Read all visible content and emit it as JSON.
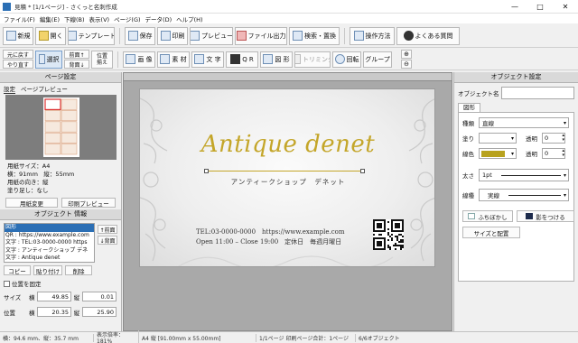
{
  "window": {
    "title": "見積 * [1/1ページ] - さくっと名刺作成",
    "controls": [
      "—",
      "□",
      "✕"
    ]
  },
  "menu": [
    "ファイル(F)",
    "編集(E)",
    "下線(B)",
    "表示(V)",
    "ページ(G)",
    "データ(D)",
    "ヘルプ(H)"
  ],
  "toolbar": {
    "new": "新規",
    "open": "開く",
    "template": "テンプレート",
    "save": "保存",
    "print": "印刷",
    "preview": "プレビュー",
    "file_output": "ファイル出力",
    "search_replace": "検索・置換",
    "howto": "操作方法",
    "faq": "よくある質問"
  },
  "objbar": {
    "undo": "元に戻す",
    "redo": "やり直す",
    "select": "選択",
    "front": "前面↑",
    "back": "背面↓",
    "align1": "位置",
    "align2": "揃え",
    "image": "画 像",
    "material": "素 材",
    "text": "文 字",
    "qr": "Q R",
    "shape": "図 形",
    "trimming": "トリミング",
    "rotate": "回転",
    "group": "グループ"
  },
  "page_settings": {
    "header": "ページ設定",
    "tabs": [
      "設定",
      "ページプレビュー"
    ],
    "paper_size": "用紙サイズ：A4",
    "dimensions": "横：91mm　縦：55mm",
    "orientation": "用紙の向き：縦",
    "bleed": "塗り足し：なし",
    "change_paper": "用紙変更",
    "print_preview": "印刷プレビュー"
  },
  "object_info": {
    "header": "オブジェクト 情報",
    "list": [
      "図形",
      "QR : https://www.example.com",
      "文字 : TEL:03-0000-0000  https",
      "文字 : アンティークショップ デネ",
      "文字 : Antique denet"
    ],
    "front": "↑前面",
    "back": "↓背面",
    "copy": "コピー",
    "paste": "貼り付け",
    "delete": "削除",
    "fix_position": "位置を固定",
    "size_label": "サイズ",
    "pos_label": "位置",
    "w_label": "横",
    "h_label": "縦",
    "size_w": "49.85",
    "size_h": "0.01",
    "pos_x": "20.35",
    "pos_y": "25.90"
  },
  "card": {
    "title": "Antique denet",
    "subtitle": "アンティークショップ　デネット",
    "contact": "TEL:03-0000-0000　https://www.example.com",
    "hours": "Open 11:00 – Close 19:00　定休日　毎週月曜日"
  },
  "object_settings": {
    "header": "オブジェクト設定",
    "name_label": "オブジェクト名",
    "tab": "図形",
    "type_label": "種類",
    "type_value": "直線",
    "fill_label": "塗り",
    "fill_alpha_label": "透明",
    "fill_alpha": "0",
    "line_color_label": "線色",
    "line_alpha_label": "透明",
    "line_alpha": "0",
    "width_label": "太さ",
    "width_value": "1pt",
    "style_label": "線種",
    "style_value": "実線",
    "blur": "ふちぼかし",
    "shadow": "影をつける",
    "size_position": "サイズと配置",
    "line_color": "#b8a21e"
  },
  "status": {
    "coords": "横：94.6 mm、縦：35.7 mm",
    "zoom": "表示倍率：181%",
    "paper": "A4 縦 [91.00mm x 55.00mm]",
    "pages": "1/1ページ 印刷ページ合計：1ページ",
    "objects": "6/6オブジェクト"
  },
  "colors": {
    "gold": "#c4a62a",
    "accent": "#2b6fb5"
  }
}
